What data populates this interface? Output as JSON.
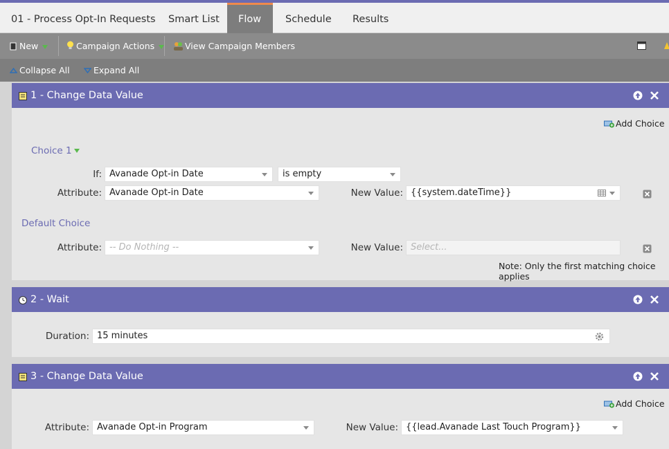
{
  "tabs": [
    {
      "label": "01 - Process Opt-In Requests",
      "active": false
    },
    {
      "label": "Smart List",
      "active": false
    },
    {
      "label": "Flow",
      "active": true
    },
    {
      "label": "Schedule",
      "active": false
    },
    {
      "label": "Results",
      "active": false
    }
  ],
  "toolbar": {
    "new_label": "New",
    "campaign_actions_label": "Campaign Actions",
    "view_members_label": "View Campaign Members"
  },
  "subbar": {
    "collapse_label": "Collapse All",
    "expand_label": "Expand All"
  },
  "colors": {
    "step_header": "#6b6bb2",
    "active_tab_accent": "#f08a4b",
    "choice_title": "#6b6bb2"
  },
  "steps": [
    {
      "title": "1 - Change Data Value",
      "add_choice_label": "Add Choice",
      "choice_label": "Choice 1",
      "if_label": "If:",
      "if_field": "Avanade Opt-in Date",
      "if_operator": "is empty",
      "attribute_label": "Attribute:",
      "attribute_value": "Avanade Opt-in Date",
      "new_value_label": "New Value:",
      "new_value": "{{system.dateTime}}",
      "default_choice_label": "Default Choice",
      "default_attribute_label": "Attribute:",
      "default_attribute_placeholder": "-- Do Nothing --",
      "default_new_value_label": "New Value:",
      "default_new_value_placeholder": "Select...",
      "note": "Note: Only the first matching choice applies"
    },
    {
      "title": "2 - Wait",
      "duration_label": "Duration:",
      "duration_value": "15 minutes"
    },
    {
      "title": "3 - Change Data Value",
      "add_choice_label": "Add Choice",
      "attribute_label": "Attribute:",
      "attribute_value": "Avanade Opt-in Program",
      "new_value_label": "New Value:",
      "new_value": "{{lead.Avanade Last Touch Program}}"
    }
  ]
}
